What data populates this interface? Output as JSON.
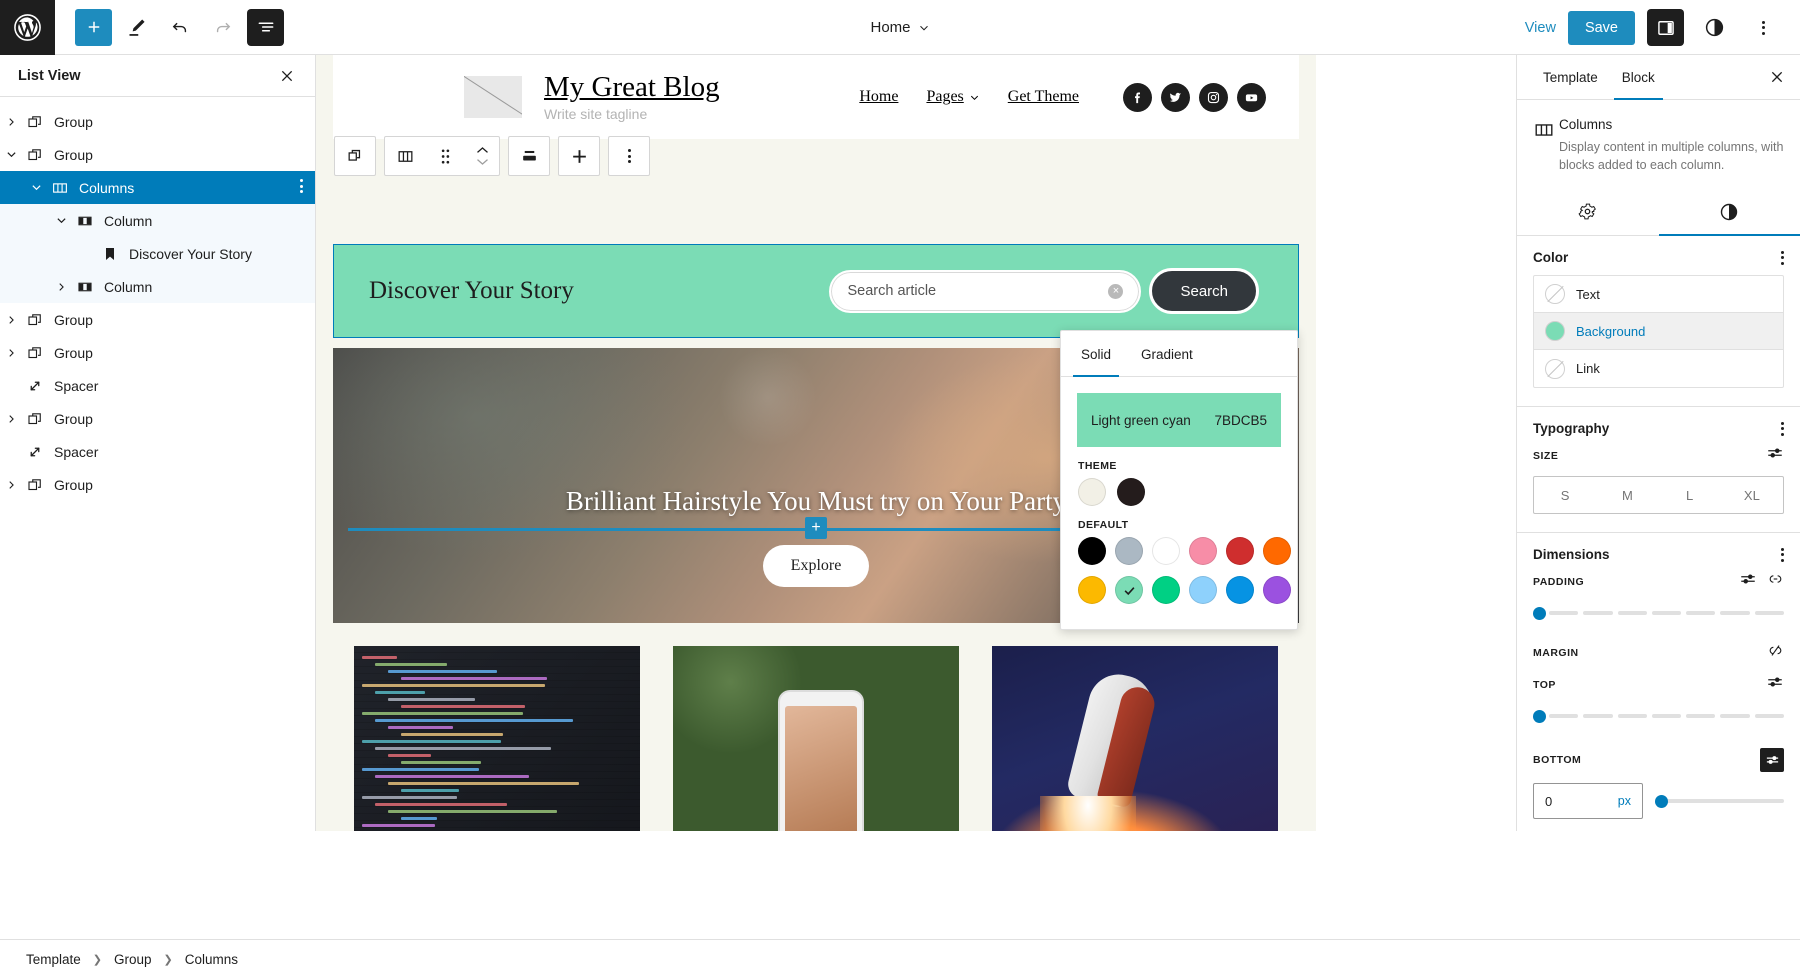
{
  "topbar": {
    "add_block": "add-block",
    "tools": "edit-tool",
    "undo": "undo",
    "redo": "redo",
    "list_view": "list-view",
    "doc_title": "Home",
    "view_label": "View",
    "save_label": "Save",
    "settings_toggle": "settings",
    "styles_toggle": "styles",
    "options": "options"
  },
  "listview": {
    "title": "List View",
    "items": [
      {
        "label": "Group",
        "icon": "group",
        "indent": 0,
        "chevron": "right",
        "state": ""
      },
      {
        "label": "Group",
        "icon": "group",
        "indent": 0,
        "chevron": "down",
        "state": ""
      },
      {
        "label": "Columns",
        "icon": "columns",
        "indent": 1,
        "chevron": "down",
        "state": "selected"
      },
      {
        "label": "Column",
        "icon": "column",
        "indent": 2,
        "chevron": "down",
        "state": "inbranch"
      },
      {
        "label": "Discover Your Story",
        "icon": "heading",
        "indent": 3,
        "chevron": "none",
        "state": "inbranch"
      },
      {
        "label": "Column",
        "icon": "column",
        "indent": 2,
        "chevron": "right",
        "state": "inbranch"
      },
      {
        "label": "Group",
        "icon": "group",
        "indent": 0,
        "chevron": "right",
        "state": ""
      },
      {
        "label": "Group",
        "icon": "group",
        "indent": 0,
        "chevron": "right",
        "state": ""
      },
      {
        "label": "Spacer",
        "icon": "spacer",
        "indent": 0,
        "chevron": "none",
        "state": ""
      },
      {
        "label": "Group",
        "icon": "group",
        "indent": 0,
        "chevron": "right",
        "state": ""
      },
      {
        "label": "Spacer",
        "icon": "spacer",
        "indent": 0,
        "chevron": "none",
        "state": ""
      },
      {
        "label": "Group",
        "icon": "group",
        "indent": 0,
        "chevron": "right",
        "state": ""
      }
    ]
  },
  "toolbar": {
    "buttons": [
      "select-parent",
      "block-type-columns",
      "drag-handle",
      "move-up-down",
      "align",
      "vertical-align",
      "more-options"
    ]
  },
  "canvas": {
    "site_title": "My Great Blog",
    "site_tagline": "Write site tagline",
    "nav": [
      {
        "label": "Home",
        "has_chevron": false
      },
      {
        "label": "Pages",
        "has_chevron": true
      },
      {
        "label": "Get Theme",
        "has_chevron": false
      }
    ],
    "social": [
      "facebook-icon",
      "twitter-icon",
      "instagram-icon",
      "youtube-icon"
    ],
    "columns_heading": "Discover Your Story",
    "search_placeholder": "Search article",
    "search_button": "Search",
    "hero_title": "Brilliant Hairstyle You Must try on Your Party",
    "explore_button": "Explore"
  },
  "color_popover": {
    "tabs": [
      {
        "label": "Solid",
        "active": true
      },
      {
        "label": "Gradient",
        "active": false
      }
    ],
    "current_name": "Light green cyan",
    "current_hex": "7BDCB5",
    "theme_label": "THEME",
    "theme_colors": [
      "#F2F0E6",
      "#241C1C"
    ],
    "default_label": "DEFAULT",
    "default_colors": [
      "#000000",
      "#ABB8C3",
      "#FFFFFF",
      "#F78DA7",
      "#CF2E2E",
      "#FF6900",
      "#FCB900",
      "#7BDCB5",
      "#00D084",
      "#8ED1FC",
      "#0693E3",
      "#9B51E0"
    ],
    "selected_index": 7
  },
  "sidebar": {
    "tabs": [
      {
        "label": "Template",
        "active": false
      },
      {
        "label": "Block",
        "active": true
      }
    ],
    "block_title": "Columns",
    "block_description": "Display content in multiple columns, with blocks added to each column.",
    "icon_tabs": [
      {
        "name": "settings-tab",
        "active": false
      },
      {
        "name": "styles-tab",
        "active": true
      }
    ],
    "color": {
      "title": "Color",
      "rows": [
        {
          "label": "Text",
          "swatch": "none",
          "active": false
        },
        {
          "label": "Background",
          "swatch": "#7BDCB5",
          "active": true
        },
        {
          "label": "Link",
          "swatch": "none",
          "active": false
        }
      ]
    },
    "typography": {
      "title": "Typography",
      "size_label": "SIZE",
      "sizes": [
        "S",
        "M",
        "L",
        "XL"
      ]
    },
    "dimensions": {
      "title": "Dimensions",
      "padding_label": "PADDING",
      "padding_value": 0,
      "margin_label": "MARGIN",
      "top_label": "TOP",
      "top_value": 0,
      "bottom_label": "BOTTOM",
      "bottom_value": "0",
      "bottom_unit": "px"
    }
  },
  "footer": {
    "breadcrumb": [
      "Template",
      "Group",
      "Columns"
    ]
  }
}
